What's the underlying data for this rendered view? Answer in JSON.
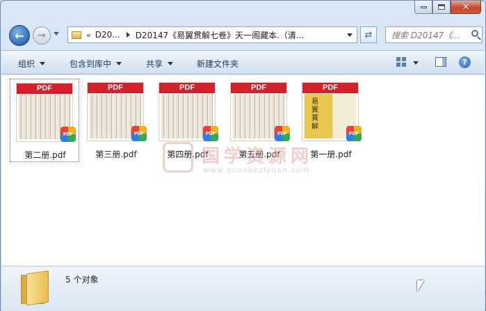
{
  "window": {
    "controls": {
      "minimize": "",
      "maximize": "",
      "close": "✕"
    }
  },
  "navigation": {
    "back_icon": "arrow-left",
    "forward_icon": "arrow-right",
    "address": {
      "chevron": "«",
      "segment": "D20...",
      "path": "D20147《易翼贯解七卷》天一阁藏本.（清..."
    },
    "search": {
      "placeholder": "搜索 D20147《..."
    }
  },
  "commandbar": {
    "organize": "组织",
    "include_in_library": "包含到库中",
    "share": "共享",
    "new_folder": "新建文件夹"
  },
  "files": [
    {
      "name": "第二册.pdf",
      "badge": "PDF",
      "selected": true,
      "cover": false
    },
    {
      "name": "第三册.pdf",
      "badge": "PDF",
      "selected": false,
      "cover": false
    },
    {
      "name": "第四册.pdf",
      "badge": "PDF",
      "selected": false,
      "cover": false
    },
    {
      "name": "第五册.pdf",
      "badge": "PDF",
      "selected": false,
      "cover": false
    },
    {
      "name": "第一册.pdf",
      "badge": "PDF",
      "selected": false,
      "cover": true,
      "cover_text": "易翼貫解"
    }
  ],
  "watermark": {
    "text": "国学资源网",
    "url": "www.guoxueziyuan.com"
  },
  "details": {
    "count": "5 个对象"
  },
  "colors": {
    "pdf_band": "#d5202b",
    "accent": "#2e6cb6",
    "close_button": "#c8482f"
  }
}
